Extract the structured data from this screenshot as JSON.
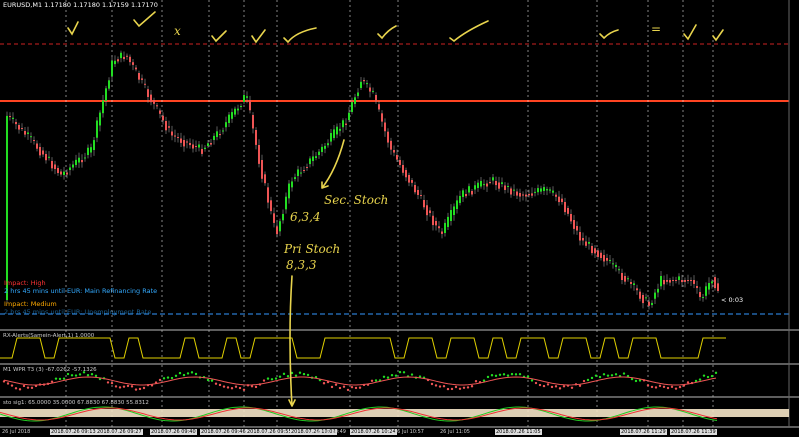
{
  "symbol_header": "EURUSD,M1  1.17180 1.17180 1.17159 1.17170",
  "news": {
    "high_impact": "Impact: High",
    "high_text": "2 hrs 45 mins until EUR: Main Refinancing Rate",
    "medium_impact": "Impact: Medium",
    "medium_text": "2 hrs 45 mins until EUR: Unemployment Rate"
  },
  "countdown": "< 0:03",
  "indicators": {
    "rsx_title": "RX-Alerts(Samein-Alert,1) 1.0000",
    "wpr_title": "M1 WPR T3 (3) -67.0262 -57.1326",
    "stoch_title": "sto sig1: 65.0000 35.0000 67.8830 67.8830 55.8312"
  },
  "annotations": {
    "secondary": "Sec. Stoch",
    "secondary_params": "6,3,4",
    "primary": "Pri Stoch",
    "primary_params": "8,3,3",
    "cross": "x",
    "equals": "="
  },
  "time_axis": [
    {
      "text": "26 Jul 2018",
      "highlight": false
    },
    {
      "text": "2018.07.26 09:13",
      "highlight": true
    },
    {
      "text": "2018.07.26 09:27",
      "highlight": true
    },
    {
      "text": "2018.07.26 09:40",
      "highlight": true
    },
    {
      "text": "2018.07.26 09:46",
      "highlight": true
    },
    {
      "text": "2018.07.26 09:55",
      "highlight": true
    },
    {
      "text": "2018.07.26 10:02",
      "highlight": true
    },
    {
      "text": "26 Jul 10:49",
      "highlight": false
    },
    {
      "text": "2018.07.26 10:24",
      "highlight": true
    },
    {
      "text": "26 Jul 10:57",
      "highlight": false
    },
    {
      "text": "26 Jul 11:05",
      "highlight": false
    },
    {
      "text": "2018.07.26 11:05",
      "highlight": true
    },
    {
      "text": "2018.07.26 11:29",
      "highlight": true
    },
    {
      "text": "2018.07.26 11:39",
      "highlight": true
    }
  ],
  "colors": {
    "background": "#000000",
    "bull_candle": "#22dd22",
    "bear_candle": "#ee5555",
    "resistance_line": "#ff4422",
    "dashed_level": "#cc2222",
    "ask_line": "#3399ff",
    "indicator_line": "#e0d000",
    "annotation_ink": "#e8d44d"
  }
}
